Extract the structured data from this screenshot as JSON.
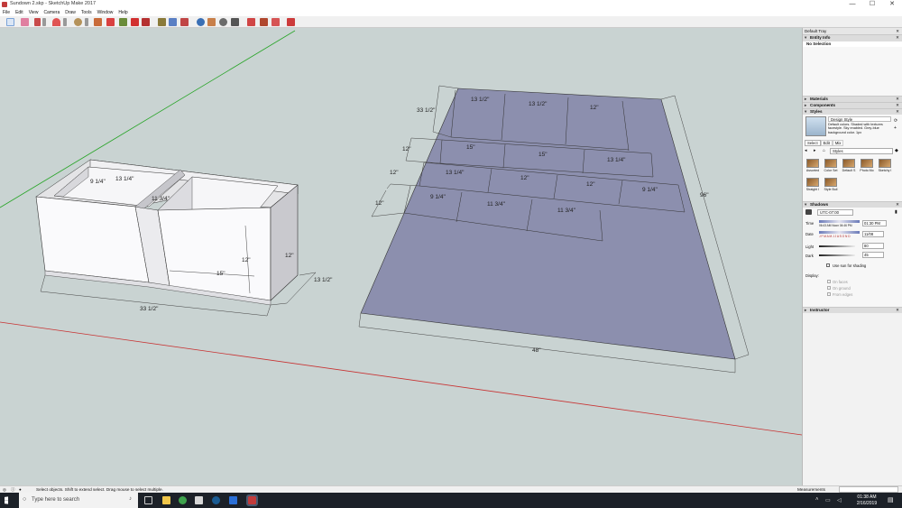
{
  "window": {
    "title": "Sundown 2.skp - SketchUp Make 2017",
    "minimize": "—",
    "maximize": "☐",
    "close": "✕"
  },
  "menu": [
    "File",
    "Edit",
    "View",
    "Camera",
    "Draw",
    "Tools",
    "Window",
    "Help"
  ],
  "toolbar_icons": [
    "select-icon",
    "eraser-icon",
    "pencil-icon",
    "chevron-down-icon",
    "arc-icon",
    "chevron-down-icon",
    "shape-icon",
    "chevron-down-icon",
    "pushpull-icon",
    "move-icon",
    "rotate-icon",
    "scale-icon",
    "tape-measure-icon",
    "paint-bucket-icon",
    "orbit-icon",
    "pan-icon",
    "zoom-icon",
    "zoom-extents-icon",
    "warehouse-icon",
    "extension-icon",
    "share-icon"
  ],
  "dimensions": {
    "box_front_width": "33 1/2\"",
    "box_depth": "13 1/2\"",
    "box_height_right": "12\"",
    "box_top_left": "13 1/4\"",
    "box_side_depth": "9 1/4\"",
    "box_divider": "11 3/4\"",
    "box_inner_height": "12\"",
    "box_inner_width": "15\"",
    "board_width": "48\"",
    "board_length": "96\"",
    "board_left_top": "33 1/2\"",
    "board_left_12a": "12\"",
    "board_left_12b": "12\"",
    "board_left_12c": "12\"",
    "r1": [
      "13 1/2\"",
      "13 1/2\"",
      "12\""
    ],
    "r2": [
      "15\"",
      "15\"",
      "13 1/4\""
    ],
    "r3": [
      "13 1/4\"",
      "12\"",
      "12\"",
      "9 1/4\""
    ],
    "r4": [
      "9 1/4\"",
      "11 3/4\"",
      "11 3/4\""
    ]
  },
  "tray": {
    "title": "Default Tray",
    "entity_info": {
      "header": "Entity Info",
      "value": "No Selection"
    },
    "materials": "Materials",
    "components": "Components",
    "styles": {
      "header": "Styles",
      "name": "Design Style",
      "description": "Default colors. Shaded with textures facestyle. Sky enabled. Grey-blue background color. 1px",
      "tabs": [
        "Select",
        "Edit",
        "Mix"
      ],
      "dropdown": "Styles",
      "thumbs": [
        "Assorted",
        "Color Set",
        "Default S",
        "Photo Mo",
        "Sketchy I",
        "Straight I",
        "Style Buil"
      ]
    },
    "shadows": {
      "header": "Shadows",
      "utc": "UTC-07:00",
      "time_label": "Time",
      "time_start": "06:43 AM",
      "time_noon": "Noon",
      "time_end": "04:46 PM",
      "time_value": "01:30 PM",
      "date_label": "Date",
      "months": "J F M A M J J A S O N D",
      "date_value": "11/08",
      "light_label": "Light",
      "light_value": "80",
      "dark_label": "Dark",
      "dark_value": "45",
      "use_sun": "Use sun for shading",
      "display_label": "Display:",
      "on_faces": "On faces",
      "on_ground": "On ground",
      "from_edges": "From edges"
    },
    "instructor": "Instructor"
  },
  "status": {
    "text": "Select objects. Shift to extend select. Drag mouse to select multiple.",
    "measurements": "Measurements"
  },
  "taskbar": {
    "search": "Type here to search",
    "time": "01:38 AM",
    "date": "2/16/2019"
  },
  "colors": {
    "sky": "#c9d3d2",
    "board": "#8c8fae",
    "box_face": "#f4f4f6",
    "green_axis": "#2aa52a",
    "red_axis": "#c83232"
  }
}
